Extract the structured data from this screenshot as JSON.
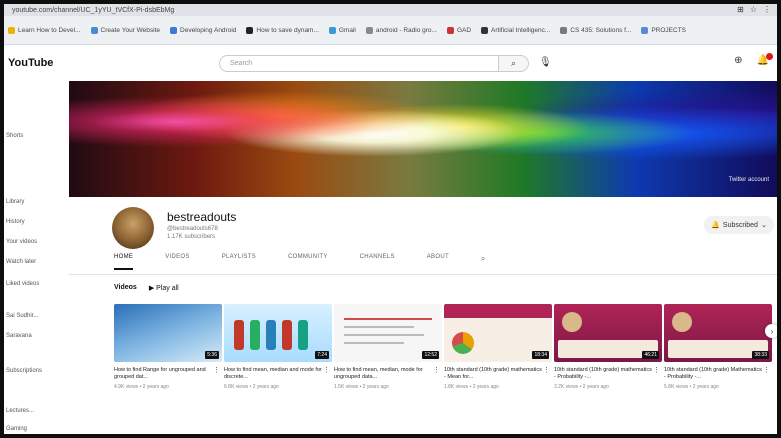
{
  "browser": {
    "url": "youtube.com/channel/UC_1yYU_tVCfX-Pi-dsbEbMg",
    "bookmarks": [
      {
        "label": "Learn How to Devel...",
        "color": "#e8b400"
      },
      {
        "label": "Create Your Website",
        "color": "#4a8ad6"
      },
      {
        "label": "Developing Android",
        "color": "#3d7ad6"
      },
      {
        "label": "How to save dynam...",
        "color": "#222222"
      },
      {
        "label": "Gmail",
        "color": "#3a9ad6"
      },
      {
        "label": "android - Radio gro...",
        "color": "#888888"
      },
      {
        "label": "GAD",
        "color": "#cc3333"
      },
      {
        "label": "Artificial Intelligenc...",
        "color": "#333333"
      },
      {
        "label": "CS 435: Solutions f...",
        "color": "#7a7a7a"
      },
      {
        "label": "PROJECTS",
        "color": "#5a8ad6"
      }
    ]
  },
  "youtube": {
    "logo": "YouTube",
    "search_placeholder": "Search",
    "sidebar": [
      "Shorts",
      "Library",
      "History",
      "Your videos",
      "Watch later",
      "Liked videos",
      "Sai Sudhir...",
      "Saravana",
      "Subscriptions",
      "Lectures...",
      "Gaming"
    ]
  },
  "channel": {
    "name": "bestreadouts",
    "handle": "@bestreadouts678",
    "subscribers": "1.17K subscribers",
    "subscribed_label": "Subscribed",
    "banner_link": "Twitter account",
    "tabs": [
      "HOME",
      "VIDEOS",
      "PLAYLISTS",
      "COMMUNITY",
      "CHANNELS",
      "ABOUT"
    ],
    "section_title": "Videos",
    "play_all": "Play all"
  },
  "videos": [
    {
      "title": "How to find Range for ungrouped and grouped dat...",
      "meta": "4.9K views • 2 years ago",
      "duration": "5:36"
    },
    {
      "title": "How to find mean, median and mode for discrete...",
      "meta": "6.8K views • 2 years ago",
      "duration": "7:24"
    },
    {
      "title": "How to find mean, median, mode for ungrouped data...",
      "meta": "1.5K views • 2 years ago",
      "duration": "12:52"
    },
    {
      "title": "10th standard (10th grade) mathematics - Mean for...",
      "meta": "1.8K views • 2 years ago",
      "duration": "18:34"
    },
    {
      "title": "10th standard (10th grade) mathematics - Probability -...",
      "meta": "3.2K views • 2 years ago",
      "duration": "46:21"
    },
    {
      "title": "10th standard (10th grade) Mathematics - Probability -...",
      "meta": "5.8K views • 2 years ago",
      "duration": "38:33"
    }
  ]
}
